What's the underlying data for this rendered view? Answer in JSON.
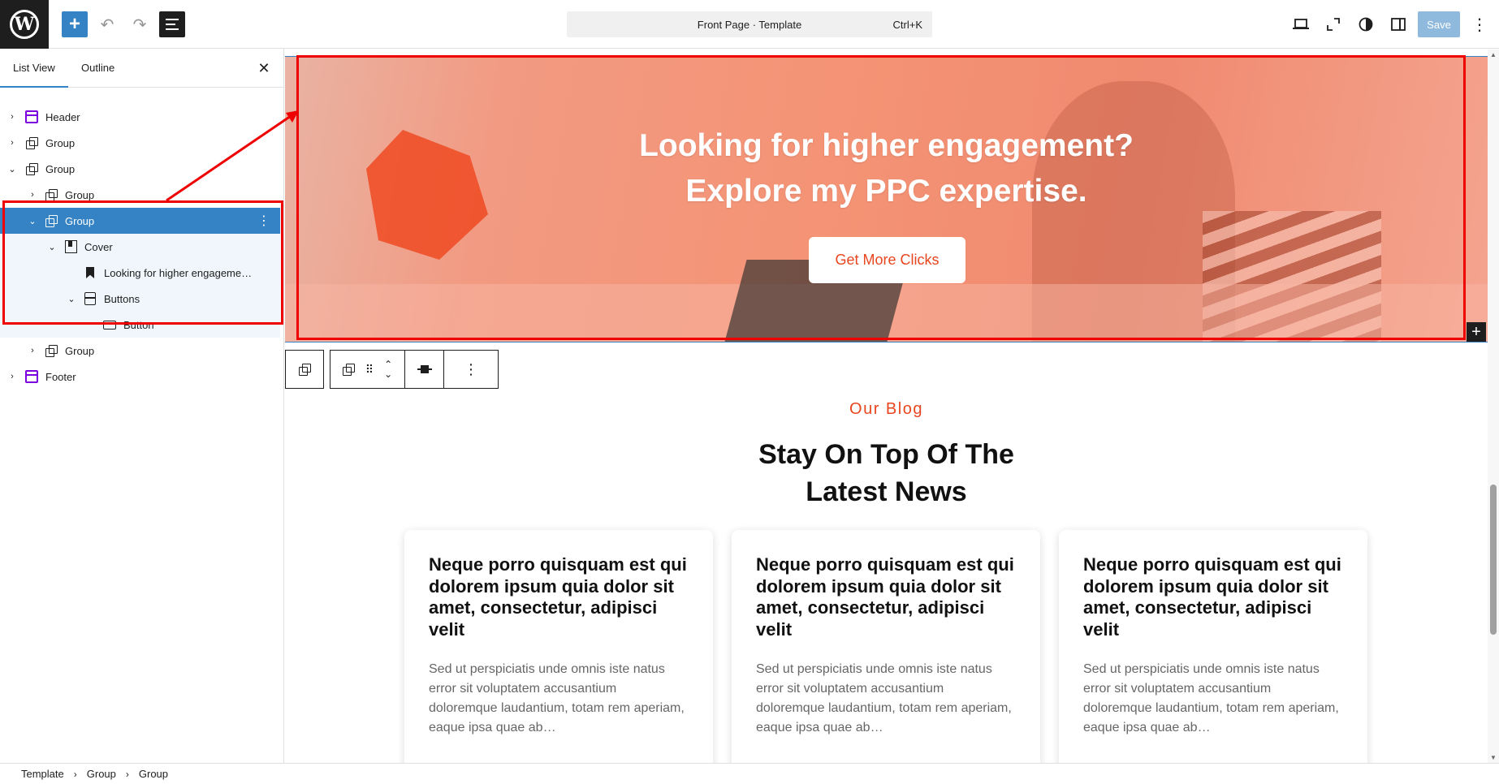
{
  "topbar": {
    "logo": "W",
    "add_icon": "plus-icon",
    "undo_icon": "undo-icon",
    "redo_icon": "redo-icon",
    "command": {
      "title": "Front Page · Template",
      "shortcut": "Ctrl+K"
    },
    "save_label": "Save",
    "accent": "#3582c4"
  },
  "panel": {
    "tabs": [
      "List View",
      "Outline"
    ],
    "close_icon": "close-icon",
    "tree": [
      {
        "label": "Header",
        "icon": "template-part-icon",
        "chevron": "right"
      },
      {
        "label": "Group",
        "icon": "group-icon",
        "chevron": "right"
      },
      {
        "label": "Group",
        "icon": "group-icon",
        "chevron": "down"
      },
      {
        "label": "Group",
        "icon": "group-icon",
        "chevron": "right"
      },
      {
        "label": "Group",
        "icon": "group-icon",
        "chevron": "down",
        "selected": true
      },
      {
        "label": "Cover",
        "icon": "cover-icon",
        "chevron": "down"
      },
      {
        "label": "Looking for higher engageme…",
        "icon": "heading-bookmark-icon",
        "chevron": ""
      },
      {
        "label": "Buttons",
        "icon": "buttons-icon",
        "chevron": "down"
      },
      {
        "label": "Button",
        "icon": "button-icon",
        "chevron": ""
      },
      {
        "label": "Group",
        "icon": "group-icon",
        "chevron": "right"
      },
      {
        "label": "Footer",
        "icon": "template-part-icon",
        "chevron": "right"
      }
    ]
  },
  "cover": {
    "title_line1": "Looking for higher engagement?",
    "title_line2": "Explore my PPC expertise.",
    "button_label": "Get More Clicks",
    "overlay_color": "#f4856a",
    "button_text_color": "#e8461f"
  },
  "blog": {
    "eyebrow": "Our Blog",
    "title_line1": "Stay On Top Of The",
    "title_line2": "Latest News",
    "cards": [
      {
        "title": "Neque porro quisquam est qui dolorem ipsum quia dolor sit amet, consectetur, adipisci velit",
        "excerpt": "Sed ut perspiciatis unde omnis iste natus error sit voluptatem accusantium doloremque laudantium, totam rem aperiam, eaque ipsa quae ab…"
      },
      {
        "title": "Neque porro quisquam est qui dolorem ipsum quia dolor sit amet, consectetur, adipisci velit",
        "excerpt": "Sed ut perspiciatis unde omnis iste natus error sit voluptatem accusantium doloremque laudantium, totam rem aperiam, eaque ipsa quae ab…"
      },
      {
        "title": "Neque porro quisquam est qui dolorem ipsum quia dolor sit amet, consectetur, adipisci velit",
        "excerpt": "Sed ut perspiciatis unde omnis iste natus error sit voluptatem accusantium doloremque laudantium, totam rem aperiam, eaque ipsa quae ab…"
      }
    ]
  },
  "breadcrumb": [
    "Template",
    "Group",
    "Group"
  ]
}
